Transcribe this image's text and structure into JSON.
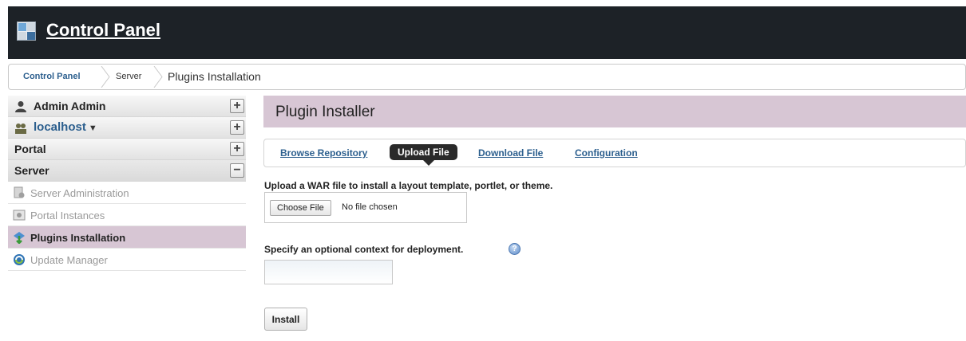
{
  "header": {
    "title": "Control Panel",
    "logo_icon": "control-panel-logo-icon"
  },
  "breadcrumb": {
    "items": [
      "Control Panel",
      "Server",
      "Plugins Installation"
    ]
  },
  "sidebar": {
    "user": {
      "label": "Admin Admin",
      "icon": "user-icon",
      "toggle": "+"
    },
    "site": {
      "label": "localhost",
      "caret": "▼",
      "icon": "users-group-icon",
      "toggle": "+"
    },
    "portal": {
      "label": "Portal",
      "toggle": "+"
    },
    "server": {
      "label": "Server",
      "toggle": "−",
      "items": [
        {
          "label": "Server Administration",
          "icon": "server-admin-icon",
          "active": false
        },
        {
          "label": "Portal Instances",
          "icon": "portal-instances-icon",
          "active": false
        },
        {
          "label": "Plugins Installation",
          "icon": "plugins-installation-icon",
          "active": true
        },
        {
          "label": "Update Manager",
          "icon": "update-manager-icon",
          "active": false
        }
      ]
    }
  },
  "main": {
    "title": "Plugin Installer",
    "tabs": [
      {
        "label": "Browse Repository",
        "active": false
      },
      {
        "label": "Upload File",
        "active": true
      },
      {
        "label": "Download File",
        "active": false
      },
      {
        "label": "Configuration",
        "active": false
      }
    ],
    "upload_label": "Upload a WAR file to install a layout template, portlet, or theme.",
    "choose_file_label": "Choose File",
    "no_file_text": "No file chosen",
    "context_label": "Specify an optional context for deployment.",
    "context_value": "",
    "install_label": "Install"
  },
  "colors": {
    "header_bg": "#1d2227",
    "accent_panel": "#d7c6d4",
    "link": "#2c5f8e"
  }
}
